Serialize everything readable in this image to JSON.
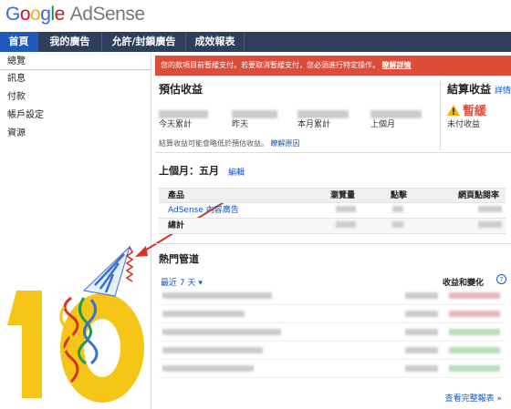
{
  "logo": {
    "letters": [
      "G",
      "o",
      "o",
      "g",
      "l",
      "e"
    ],
    "product": "AdSense"
  },
  "nav": {
    "tabs": [
      "首頁",
      "我的廣告",
      "允許/封鎖廣告",
      "成效報表"
    ]
  },
  "sidebar": {
    "items": [
      "總覽",
      "訊息",
      "付款",
      "帳戶設定",
      "資源"
    ]
  },
  "alert": {
    "text": "您的款項目前暫緩支付。若要取消暫緩支付，您必須進行特定操作。",
    "link": "瞭解詳情"
  },
  "earnings": {
    "title": "預估收益",
    "periods": [
      "今天累計",
      "昨天",
      "本月累計",
      "上個月"
    ],
    "note": "結算收益可能會略低於預估收益。",
    "note_link": "瞭解原因"
  },
  "finalized": {
    "title": "結算收益",
    "detail_link": "詳情",
    "status": "暫緩",
    "status_sub": "未付收益"
  },
  "last_month": {
    "title": "上個月：五月",
    "edit": "編輯",
    "headers": [
      "產品",
      "瀏覽量",
      "點擊",
      "網頁點閱率"
    ],
    "rows": [
      {
        "product": "AdSense 內容廣告"
      },
      {
        "product": "總計"
      }
    ]
  },
  "channels": {
    "title": "熱門管道",
    "range": "最近 7 天",
    "right_header": "收益和變化",
    "help": "?",
    "full_report": "查看完整報表 »"
  },
  "colors": {
    "nav_bg": "#2d3f5a",
    "nav_active": "#1f5ab8",
    "alert": "#dd4b39",
    "link": "#1155cc",
    "celebration_yellow": "#f5c518"
  }
}
